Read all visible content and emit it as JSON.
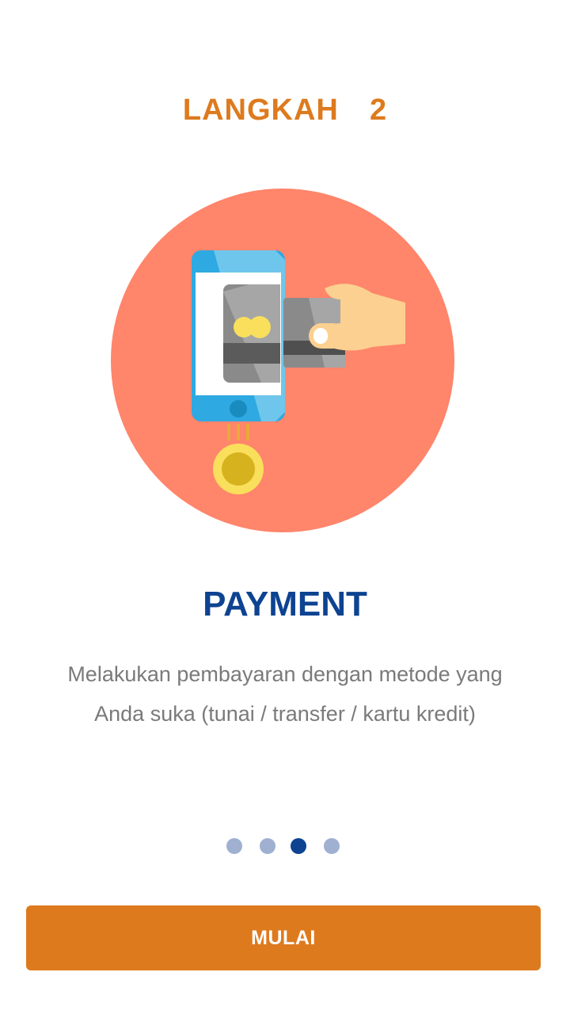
{
  "step": {
    "title": "LANGKAH  2"
  },
  "illustration": {
    "icon": "mobile-card-payment-icon",
    "colors": {
      "circle": "#ff856b",
      "phone": "#2ea9e1",
      "card": "#8a8a8a",
      "hand": "#fbd090",
      "coin": "#f9df5b"
    }
  },
  "content": {
    "heading": "PAYMENT",
    "description": "Melakukan pembayaran dengan metode yang Anda suka (tunai / transfer / kartu kredit)"
  },
  "pager": {
    "total": 4,
    "active_index": 2
  },
  "action": {
    "start_label": "MULAI"
  },
  "colors": {
    "accent": "#de7a1e",
    "heading": "#0d4391",
    "dot_inactive": "#9fb0d1",
    "dot_active": "#0d4391"
  }
}
